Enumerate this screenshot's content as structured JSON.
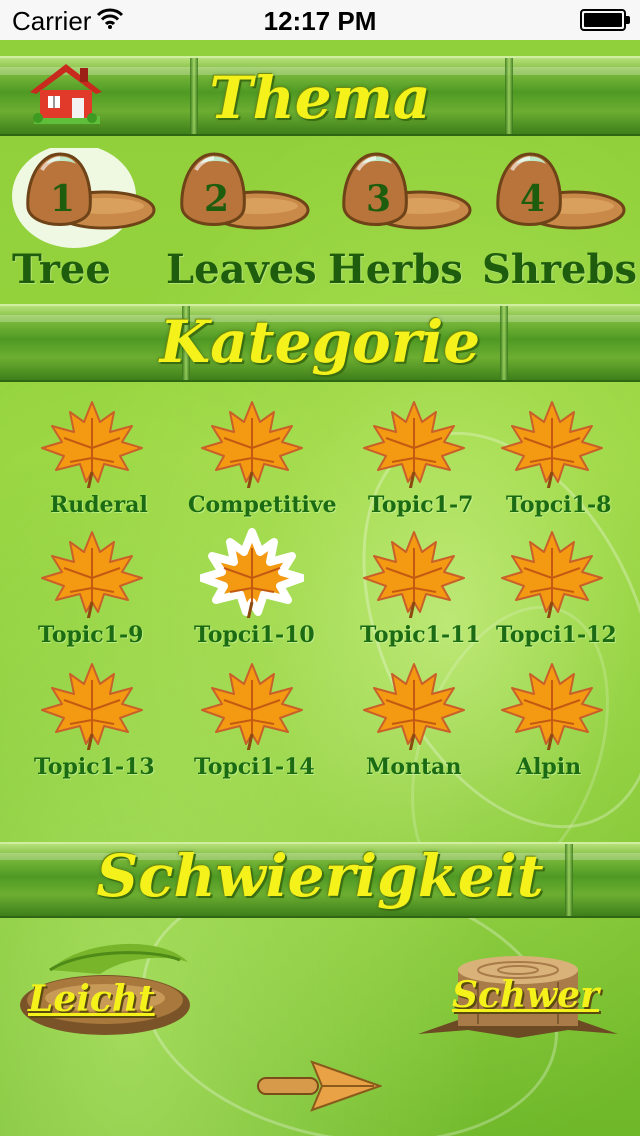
{
  "status_bar": {
    "carrier": "Carrier",
    "time": "12:17 PM"
  },
  "header": {
    "title": "Thema",
    "home_icon": "house-icon"
  },
  "themes": [
    {
      "number": "1",
      "label": "Tree",
      "selected": true
    },
    {
      "number": "2",
      "label": "Leaves",
      "selected": false
    },
    {
      "number": "3",
      "label": "Herbs",
      "selected": false
    },
    {
      "number": "4",
      "label": "Shrebs",
      "selected": false
    }
  ],
  "category_section": {
    "title": "Kategorie",
    "items": [
      {
        "label": "Ruderal",
        "selected": false
      },
      {
        "label": "Competitive",
        "selected": false
      },
      {
        "label": "Topic1-7",
        "selected": false
      },
      {
        "label": "Topci1-8",
        "selected": false
      },
      {
        "label": "Topic1-9",
        "selected": false
      },
      {
        "label": "Topci1-10",
        "selected": true
      },
      {
        "label": "Topic1-11",
        "selected": false
      },
      {
        "label": "Topci1-12",
        "selected": false
      },
      {
        "label": "Topic1-13",
        "selected": false
      },
      {
        "label": "Topci1-14",
        "selected": false
      },
      {
        "label": "Montan",
        "selected": false
      },
      {
        "label": "Alpin",
        "selected": false
      }
    ]
  },
  "difficulty_section": {
    "title": "Schwierigkeit",
    "easy_label": "Leicht",
    "hard_label": "Schwer"
  },
  "colors": {
    "title_yellow": "#f4f21a",
    "label_green": "#1a6b13",
    "leaf_orange": "#f39a12"
  }
}
